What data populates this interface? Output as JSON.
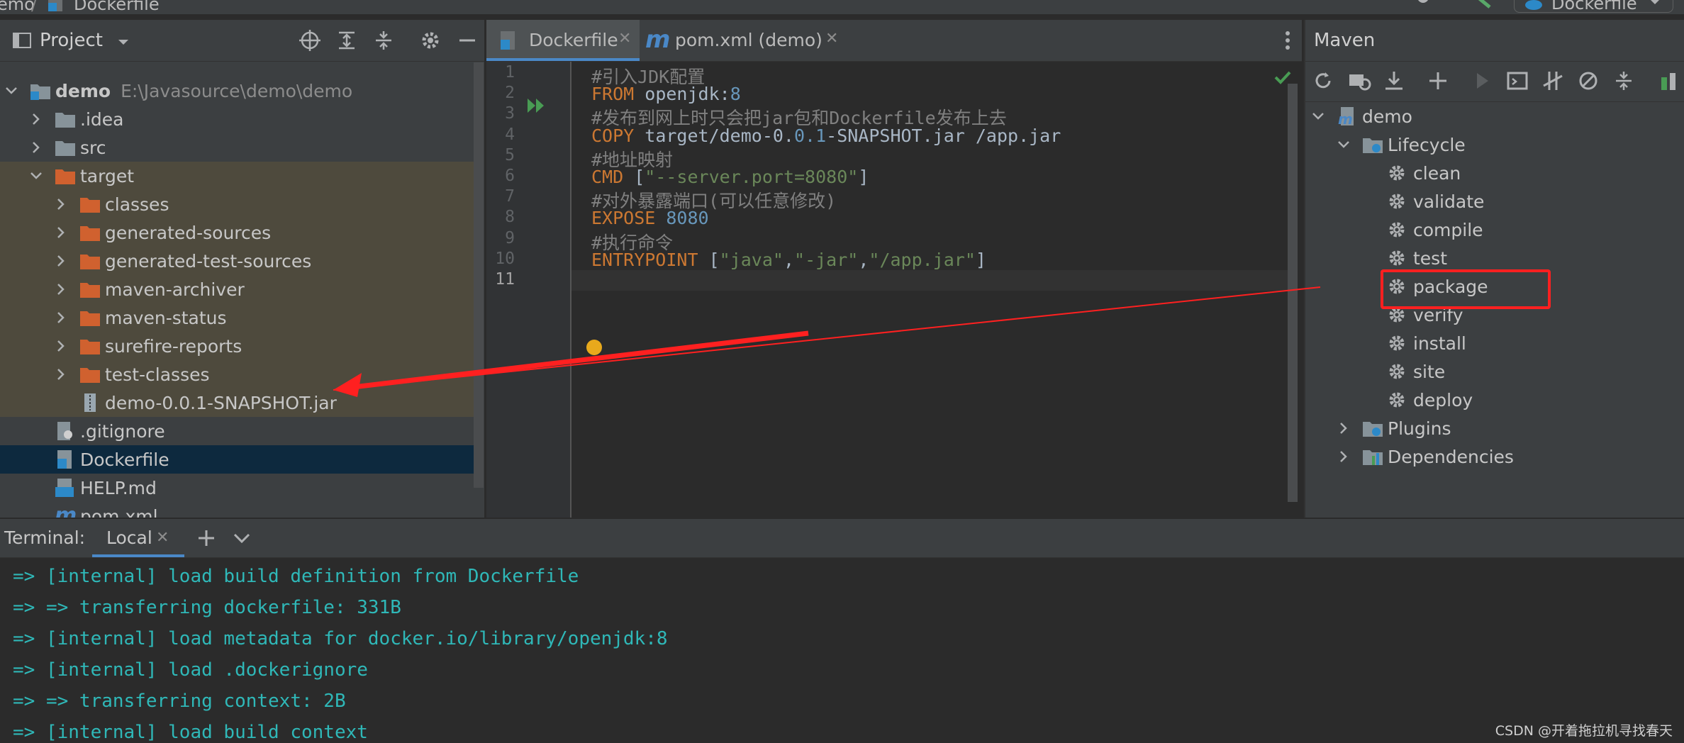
{
  "breadcrumb": {
    "project": "emo",
    "sep": "/",
    "file": "Dockerfile"
  },
  "run_config": {
    "label": "Dockerfile"
  },
  "project_panel": {
    "title": "Project",
    "tree": [
      {
        "label": "demo",
        "path": "E:\\Javasource\\demo\\demo",
        "bold": true,
        "icon": "module-folder-icon",
        "depth": 0,
        "expanded": true
      },
      {
        "label": ".idea",
        "icon": "folder-icon",
        "depth": 1,
        "expanded": false
      },
      {
        "label": "src",
        "icon": "folder-icon",
        "depth": 1,
        "expanded": false
      },
      {
        "label": "target",
        "icon": "excluded-folder-icon",
        "depth": 1,
        "expanded": true
      },
      {
        "label": "classes",
        "icon": "excluded-folder-icon",
        "depth": 2,
        "expanded": false
      },
      {
        "label": "generated-sources",
        "icon": "excluded-folder-icon",
        "depth": 2,
        "expanded": false
      },
      {
        "label": "generated-test-sources",
        "icon": "excluded-folder-icon",
        "depth": 2,
        "expanded": false
      },
      {
        "label": "maven-archiver",
        "icon": "excluded-folder-icon",
        "depth": 2,
        "expanded": false
      },
      {
        "label": "maven-status",
        "icon": "excluded-folder-icon",
        "depth": 2,
        "expanded": false
      },
      {
        "label": "surefire-reports",
        "icon": "excluded-folder-icon",
        "depth": 2,
        "expanded": false
      },
      {
        "label": "test-classes",
        "icon": "excluded-folder-icon",
        "depth": 2,
        "expanded": false
      },
      {
        "label": "demo-0.0.1-SNAPSHOT.jar",
        "icon": "jar-file-icon",
        "depth": 2
      },
      {
        "label": ".gitignore",
        "icon": "gitignore-file-icon",
        "depth": 1
      },
      {
        "label": "Dockerfile",
        "icon": "docker-file-icon",
        "depth": 1,
        "selected": true
      },
      {
        "label": "HELP.md",
        "icon": "markdown-file-icon",
        "depth": 1
      },
      {
        "label": "pom.xml",
        "icon": "maven-file-icon",
        "depth": 1
      }
    ]
  },
  "editor": {
    "tabs": [
      {
        "label": "Dockerfile",
        "icon": "docker-file-icon",
        "active": true
      },
      {
        "label": "pom.xml (demo)",
        "icon": "maven-file-icon",
        "active": false
      }
    ],
    "lines": [
      [
        {
          "t": "#引入JDK配置",
          "c": "comment"
        }
      ],
      [
        {
          "t": "FROM ",
          "c": "kw"
        },
        {
          "t": "openjdk:",
          "c": "plain"
        },
        {
          "t": "8",
          "c": "num"
        }
      ],
      [
        {
          "t": "#发布到网上时只会把jar包和Dockerfile发布上去",
          "c": "comment"
        }
      ],
      [
        {
          "t": "COPY ",
          "c": "kw"
        },
        {
          "t": "target/demo-0.",
          "c": "plain"
        },
        {
          "t": "0.1",
          "c": "num"
        },
        {
          "t": "-SNAPSHOT.jar /app.jar",
          "c": "plain"
        }
      ],
      [
        {
          "t": "#地址映射",
          "c": "comment"
        }
      ],
      [
        {
          "t": "CMD ",
          "c": "kw"
        },
        {
          "t": "[",
          "c": "plain"
        },
        {
          "t": "\"--server.port=8080\"",
          "c": "str"
        },
        {
          "t": "]",
          "c": "plain"
        }
      ],
      [
        {
          "t": "#对外暴露端口(可以任意修改)",
          "c": "comment"
        }
      ],
      [
        {
          "t": "EXPOSE ",
          "c": "kw"
        },
        {
          "t": "8080",
          "c": "num"
        }
      ],
      [
        {
          "t": "#执行命令",
          "c": "comment"
        }
      ],
      [
        {
          "t": "ENTRYPOINT ",
          "c": "kw"
        },
        {
          "t": "[",
          "c": "plain"
        },
        {
          "t": "\"java\"",
          "c": "str"
        },
        {
          "t": ",",
          "c": "plain"
        },
        {
          "t": "\"-jar\"",
          "c": "str"
        },
        {
          "t": ",",
          "c": "plain"
        },
        {
          "t": "\"/app.jar\"",
          "c": "str"
        },
        {
          "t": "]",
          "c": "plain"
        }
      ],
      []
    ],
    "line_numbers": [
      "1",
      "2",
      "3",
      "4",
      "5",
      "6",
      "7",
      "8",
      "9",
      "10",
      "11"
    ]
  },
  "maven_panel": {
    "title": "Maven",
    "tree": [
      {
        "label": "demo",
        "icon": "maven-project-icon",
        "depth": 0,
        "expanded": true
      },
      {
        "label": "Lifecycle",
        "icon": "lifecycle-folder-icon",
        "depth": 1,
        "expanded": true
      },
      {
        "label": "clean",
        "icon": "gear-icon",
        "depth": 2
      },
      {
        "label": "validate",
        "icon": "gear-icon",
        "depth": 2
      },
      {
        "label": "compile",
        "icon": "gear-icon",
        "depth": 2
      },
      {
        "label": "test",
        "icon": "gear-icon",
        "depth": 2
      },
      {
        "label": "package",
        "icon": "gear-icon",
        "depth": 2,
        "highlighted": true
      },
      {
        "label": "verify",
        "icon": "gear-icon",
        "depth": 2
      },
      {
        "label": "install",
        "icon": "gear-icon",
        "depth": 2
      },
      {
        "label": "site",
        "icon": "gear-icon",
        "depth": 2
      },
      {
        "label": "deploy",
        "icon": "gear-icon",
        "depth": 2
      },
      {
        "label": "Plugins",
        "icon": "plugins-folder-icon",
        "depth": 1,
        "expanded": false
      },
      {
        "label": "Dependencies",
        "icon": "dependencies-folder-icon",
        "depth": 1,
        "expanded": false
      }
    ]
  },
  "terminal": {
    "title": "Terminal:",
    "tab": "Local",
    "lines": [
      "=> [internal] load build definition from Dockerfile",
      "=> => transferring dockerfile: 331B",
      "=> [internal] load metadata for docker.io/library/openjdk:8",
      "=> [internal] load .dockerignore",
      "=> => transferring context: 2B",
      "=> [internal] load build context"
    ]
  },
  "watermark": "CSDN @开着拖拉机寻找春天",
  "colors": {
    "accent": "#4a88c7",
    "annotation_red": "#ff2020",
    "terminal_text": "#2fb8b8"
  }
}
